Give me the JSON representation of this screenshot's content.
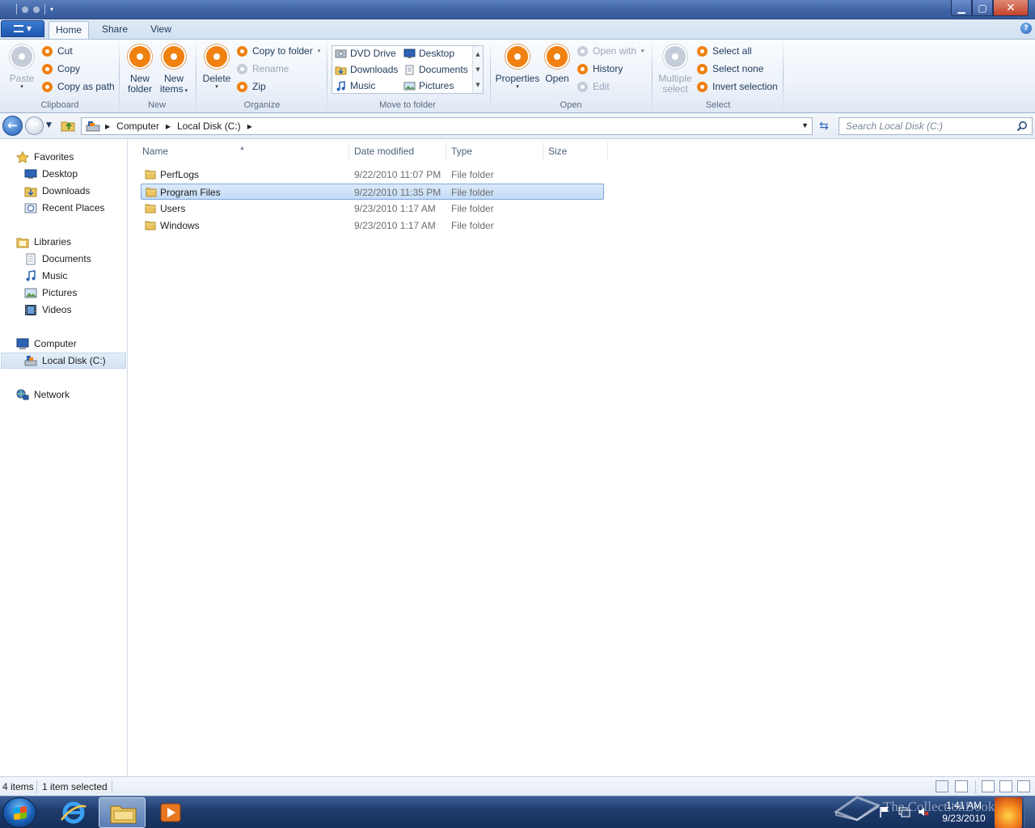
{
  "ribbon": {
    "tabs": [
      "Home",
      "Share",
      "View"
    ],
    "clipboard": {
      "paste": "Paste",
      "cut": "Cut",
      "copy": "Copy",
      "copy_as_path": "Copy as path",
      "label": "Clipboard"
    },
    "new": {
      "new_folder_1": "New",
      "new_folder_2": "folder",
      "new_items_1": "New",
      "new_items_2": "items",
      "label": "New"
    },
    "organize": {
      "delete": "Delete",
      "copy_to_folder": "Copy to folder",
      "rename": "Rename",
      "zip": "Zip",
      "label": "Organize"
    },
    "move_to_folder": {
      "items": [
        "DVD Drive",
        "Desktop",
        "Downloads",
        "Documents",
        "Music",
        "Pictures"
      ],
      "label": "Move to folder"
    },
    "open": {
      "properties": "Properties",
      "open": "Open",
      "open_with": "Open with",
      "history": "History",
      "edit": "Edit",
      "label": "Open"
    },
    "select": {
      "multiple_1": "Multiple",
      "multiple_2": "select",
      "select_all": "Select all",
      "select_none": "Select none",
      "invert_selection": "Invert selection",
      "label": "Select"
    }
  },
  "address": {
    "crumbs": [
      "Computer",
      "Local Disk (C:)"
    ]
  },
  "search": {
    "placeholder": "Search Local Disk (C:)"
  },
  "nav": {
    "favorites": "Favorites",
    "favorites_items": [
      "Desktop",
      "Downloads",
      "Recent Places"
    ],
    "libraries": "Libraries",
    "libraries_items": [
      "Documents",
      "Music",
      "Pictures",
      "Videos"
    ],
    "computer": "Computer",
    "computer_items": [
      "Local Disk (C:)"
    ],
    "network": "Network",
    "selected": "Local Disk (C:)"
  },
  "files": {
    "columns": [
      "Name",
      "Date modified",
      "Type",
      "Size"
    ],
    "rows": [
      {
        "name": "PerfLogs",
        "date": "9/22/2010 11:07 PM",
        "type": "File folder",
        "size": ""
      },
      {
        "name": "Program Files",
        "date": "9/22/2010 11:35 PM",
        "type": "File folder",
        "size": ""
      },
      {
        "name": "Users",
        "date": "9/23/2010 1:17 AM",
        "type": "File folder",
        "size": ""
      },
      {
        "name": "Windows",
        "date": "9/23/2010 1:17 AM",
        "type": "File folder",
        "size": ""
      }
    ],
    "selected_row": "Program Files"
  },
  "status": {
    "items": "4 items",
    "selected": "1 item selected"
  },
  "taskbar": {
    "time": "1:41 AM",
    "date": "9/23/2010",
    "watermark": "The CollectionBook"
  },
  "icons": {
    "folder": "folder-icon",
    "star": "star-icon",
    "back": "back-arrow-icon",
    "search": "search-icon"
  },
  "colors": {
    "accent": "#f08010",
    "selection": "#c3dcf7",
    "titlebar": "#3f64a6"
  }
}
